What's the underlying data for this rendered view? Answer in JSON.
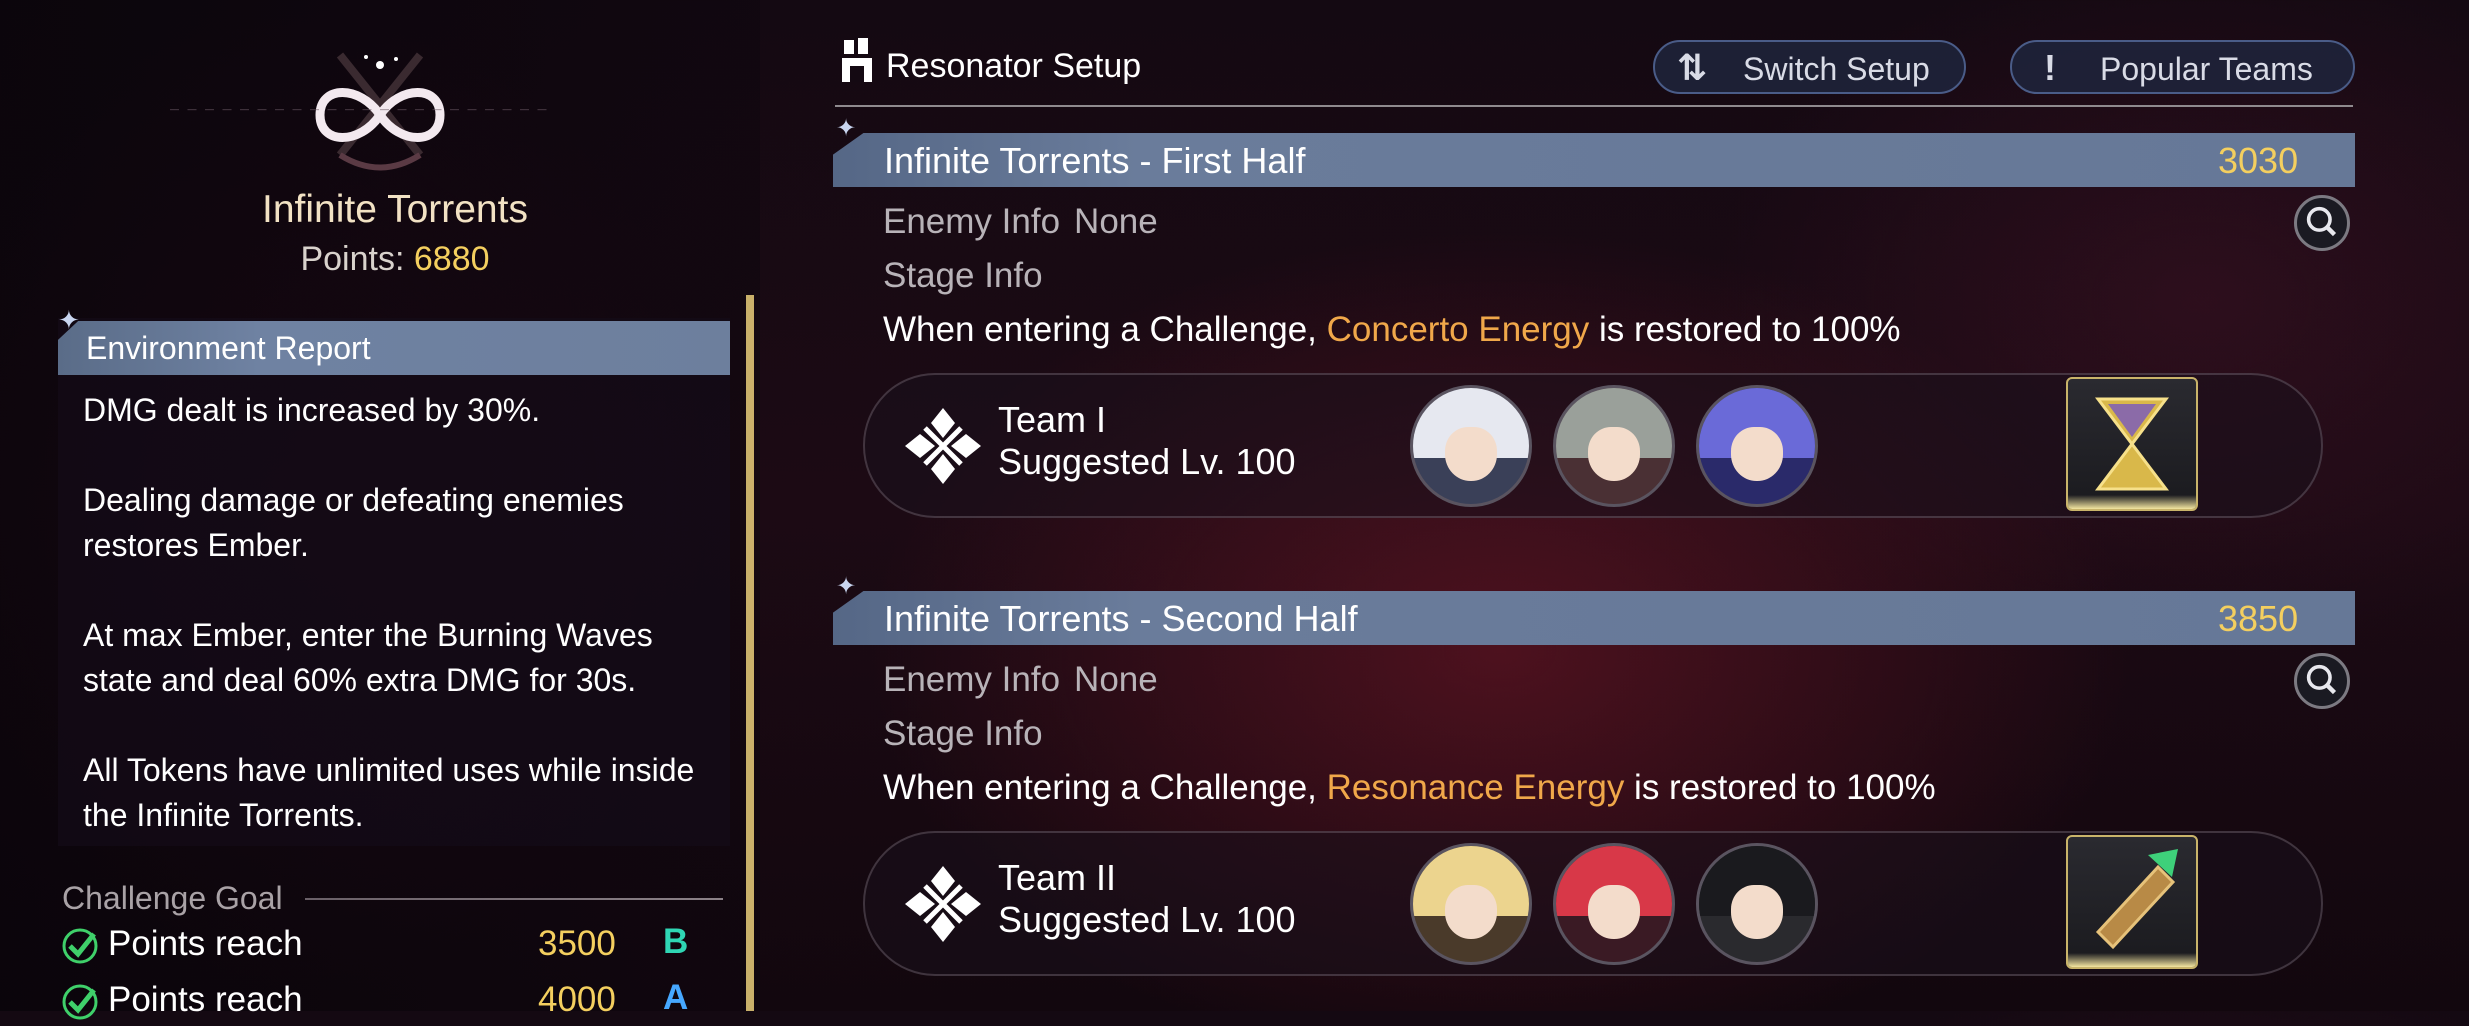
{
  "mode": {
    "title": "Infinite Torrents",
    "points_label": "Points:",
    "points_value": "6880"
  },
  "environment": {
    "header": "Environment Report",
    "paragraphs": [
      "DMG dealt is increased by 30%.",
      "Dealing damage or defeating enemies restores Ember.",
      "At max Ember, enter the Burning Waves state and deal 60% extra DMG for 30s.",
      "All Tokens have unlimited uses while inside the Infinite Torrents."
    ]
  },
  "challenge_goal": {
    "title": "Challenge Goal",
    "rows": [
      {
        "label": "Points reach",
        "value": "3500",
        "rank": "B",
        "rank_color": "#2fd6b4"
      },
      {
        "label": "Points reach",
        "value": "4000",
        "rank": "A",
        "rank_color": "#46a8ff"
      }
    ]
  },
  "setup": {
    "title": "Resonator Setup",
    "switch_label": "Switch Setup",
    "popular_label": "Popular Teams"
  },
  "halves": [
    {
      "title": "Infinite Torrents - First Half",
      "score": "3030",
      "enemy_info_label": "Enemy Info",
      "enemy_info_value": "None",
      "stage_info_label": "Stage Info",
      "desc_prefix": "When entering a Challenge, ",
      "desc_highlight": "Concerto Energy",
      "desc_suffix": " is restored to 100%",
      "team": {
        "name": "Team I",
        "level": "Suggested Lv. 100"
      }
    },
    {
      "title": "Infinite Torrents - Second Half",
      "score": "3850",
      "enemy_info_label": "Enemy Info",
      "enemy_info_value": "None",
      "stage_info_label": "Stage Info",
      "desc_prefix": "When entering a Challenge, ",
      "desc_highlight": "Resonance Energy",
      "desc_suffix": " is restored to 100%",
      "team": {
        "name": "Team II",
        "level": "Suggested Lv. 100"
      }
    }
  ],
  "colors": {
    "gold": "#f4cf5f",
    "highlight_orange": "#f0a84a",
    "header_blue": "#6a7c9b"
  }
}
